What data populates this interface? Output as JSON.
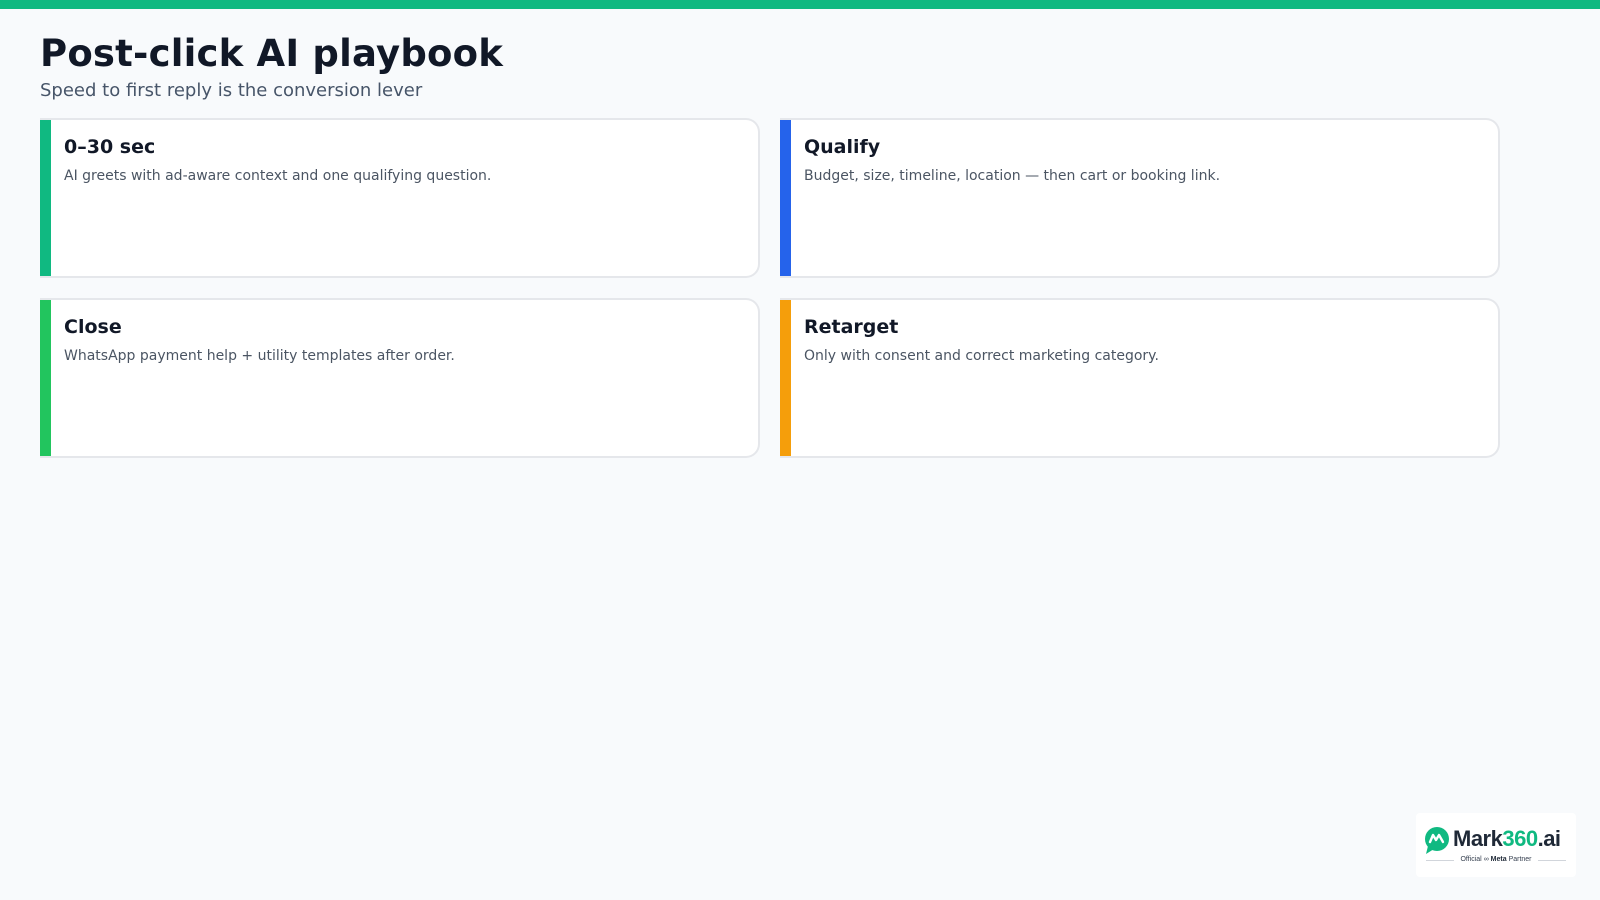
{
  "colors": {
    "top_bar": "#10b981",
    "background": "#f8fafc"
  },
  "header": {
    "title": "Post-click AI playbook",
    "subtitle": "Speed to first reply is the conversion lever"
  },
  "cards": [
    {
      "title": "0–30 sec",
      "text": "AI greets with ad-aware context and one qualifying question.",
      "accent": "#10b981"
    },
    {
      "title": "Qualify",
      "text": "Budget, size, timeline, location — then cart or booking link.",
      "accent": "#2563eb"
    },
    {
      "title": "Close",
      "text": "WhatsApp payment help + utility templates after order.",
      "accent": "#22c55e"
    },
    {
      "title": "Retarget",
      "text": "Only with consent and correct marketing category.",
      "accent": "#f59e0b"
    }
  ],
  "logo": {
    "name_part1": "Mark",
    "name_part2": "360",
    "name_part3": ".ai",
    "tag_official": "Official",
    "tag_meta": "Meta",
    "tag_partner": "Partner",
    "icon": "chat-bubble-logo-icon"
  }
}
